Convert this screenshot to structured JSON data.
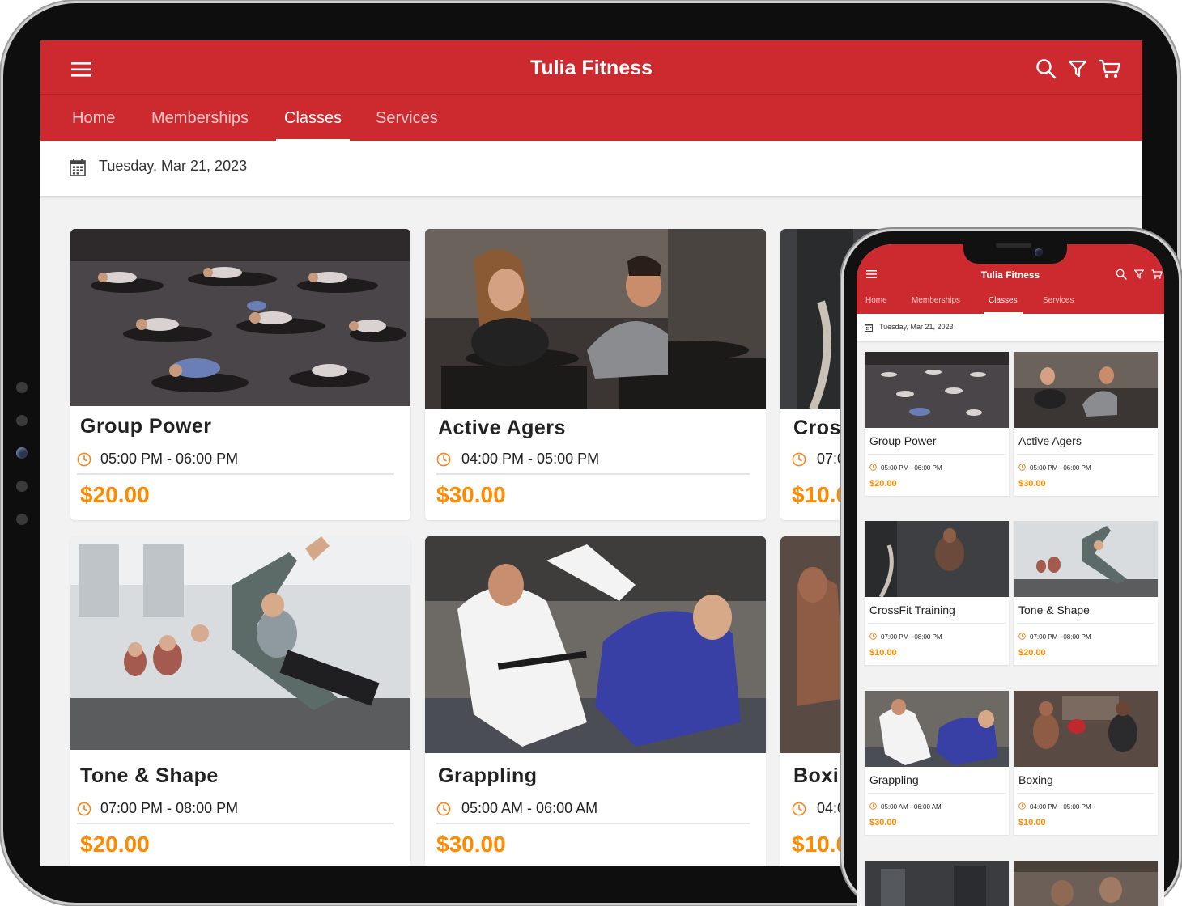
{
  "app": {
    "title": "Tulia Fitness"
  },
  "tabs": [
    {
      "label": "Home",
      "active": false
    },
    {
      "label": "Memberships",
      "active": false
    },
    {
      "label": "Classes",
      "active": true
    },
    {
      "label": "Services",
      "active": false
    }
  ],
  "header_icons": [
    "menu-icon",
    "search-icon",
    "filter-icon",
    "cart-icon"
  ],
  "date": {
    "label": "Tuesday, Mar 21, 2023",
    "icon": "calendar-icon"
  },
  "colors": {
    "brand_red": "#cc2a2f",
    "price_orange": "#ff8a00",
    "clock_orange": "#f08a24"
  },
  "tablet_classes": [
    {
      "name": "Group Power",
      "time": "05:00 PM - 06:00 PM",
      "price": "$20.00"
    },
    {
      "name": "Active Agers",
      "time": "04:00 PM - 05:00 PM",
      "price": "$30.00"
    },
    {
      "name": "Cross",
      "time": "07:0",
      "price": "$10.0"
    },
    {
      "name": "Tone & Shape",
      "time": "07:00 PM - 08:00 PM",
      "price": "$20.00"
    },
    {
      "name": "Grappling",
      "time": "05:00 AM - 06:00 AM",
      "price": "$30.00"
    },
    {
      "name": "Boxin",
      "time": "04:0",
      "price": "$10.0"
    }
  ],
  "phone_classes": [
    {
      "name": "Group Power",
      "time": "05:00 PM - 06:00 PM",
      "price": "$20.00"
    },
    {
      "name": "Active Agers",
      "time": "05:00 PM - 06:00 PM",
      "price": "$30.00"
    },
    {
      "name": "CrossFit Training",
      "time": "07:00 PM - 08:00 PM",
      "price": "$10.00"
    },
    {
      "name": "Tone & Shape",
      "time": "07:00 PM - 08:00 PM",
      "price": "$20.00"
    },
    {
      "name": "Grappling",
      "time": "05:00 AM - 06:00 AM",
      "price": "$30.00"
    },
    {
      "name": "Boxing",
      "time": "04:00 PM - 05:00 PM",
      "price": "$10.00"
    }
  ]
}
